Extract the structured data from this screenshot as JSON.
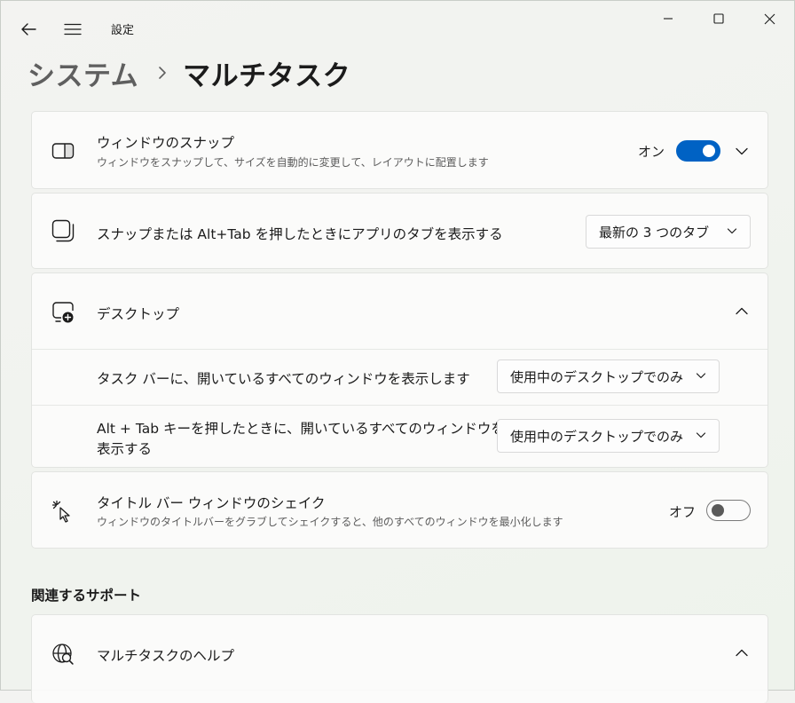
{
  "window": {
    "title": "設定"
  },
  "titlebar": {
    "back_icon": "arrow-left-icon",
    "menu_icon": "hamburger-menu-icon",
    "minimize_icon": "minimize-icon",
    "maximize_icon": "maximize-icon",
    "close_icon": "close-icon"
  },
  "breadcrumb": {
    "parent": "システム",
    "separator_icon": "chevron-right-icon",
    "current": "マルチタスク"
  },
  "snap": {
    "icon": "snap-window-icon",
    "title": "ウィンドウのスナップ",
    "subtitle": "ウィンドウをスナップして、サイズを自動的に変更して、レイアウトに配置します",
    "toggle_label": "オン",
    "toggle_state": true,
    "expand_icon": "chevron-down-icon"
  },
  "alt_tab": {
    "icon": "stacked-windows-icon",
    "title": "スナップまたは Alt+Tab を押したときにアプリのタブを表示する",
    "selected": "最新の 3 つのタブ"
  },
  "desktops": {
    "icon": "desktop-add-icon",
    "title": "デスクトップ",
    "collapse_icon": "chevron-up-icon",
    "taskbar_label": "タスク バーに、開いているすべてのウィンドウを表示します",
    "taskbar_selected": "使用中のデスクトップでのみ",
    "alttab_label_line1": "Alt + Tab キーを押したときに、開いているすべてのウィンドウを",
    "alttab_label_line2": "表示する",
    "alttab_selected": "使用中のデスクトップでのみ"
  },
  "shake": {
    "icon": "cursor-shake-icon",
    "title": "タイトル バー ウィンドウのシェイク",
    "subtitle": "ウィンドウのタイトルバーをグラブしてシェイクすると、他のすべてのウィンドウを最小化します",
    "toggle_label": "オフ",
    "toggle_state": false
  },
  "related": {
    "heading": "関連するサポート",
    "help_icon": "globe-search-icon",
    "help_title": "マルチタスクのヘルプ",
    "collapse_icon": "chevron-up-icon"
  },
  "colors": {
    "accent": "#0062c4"
  }
}
